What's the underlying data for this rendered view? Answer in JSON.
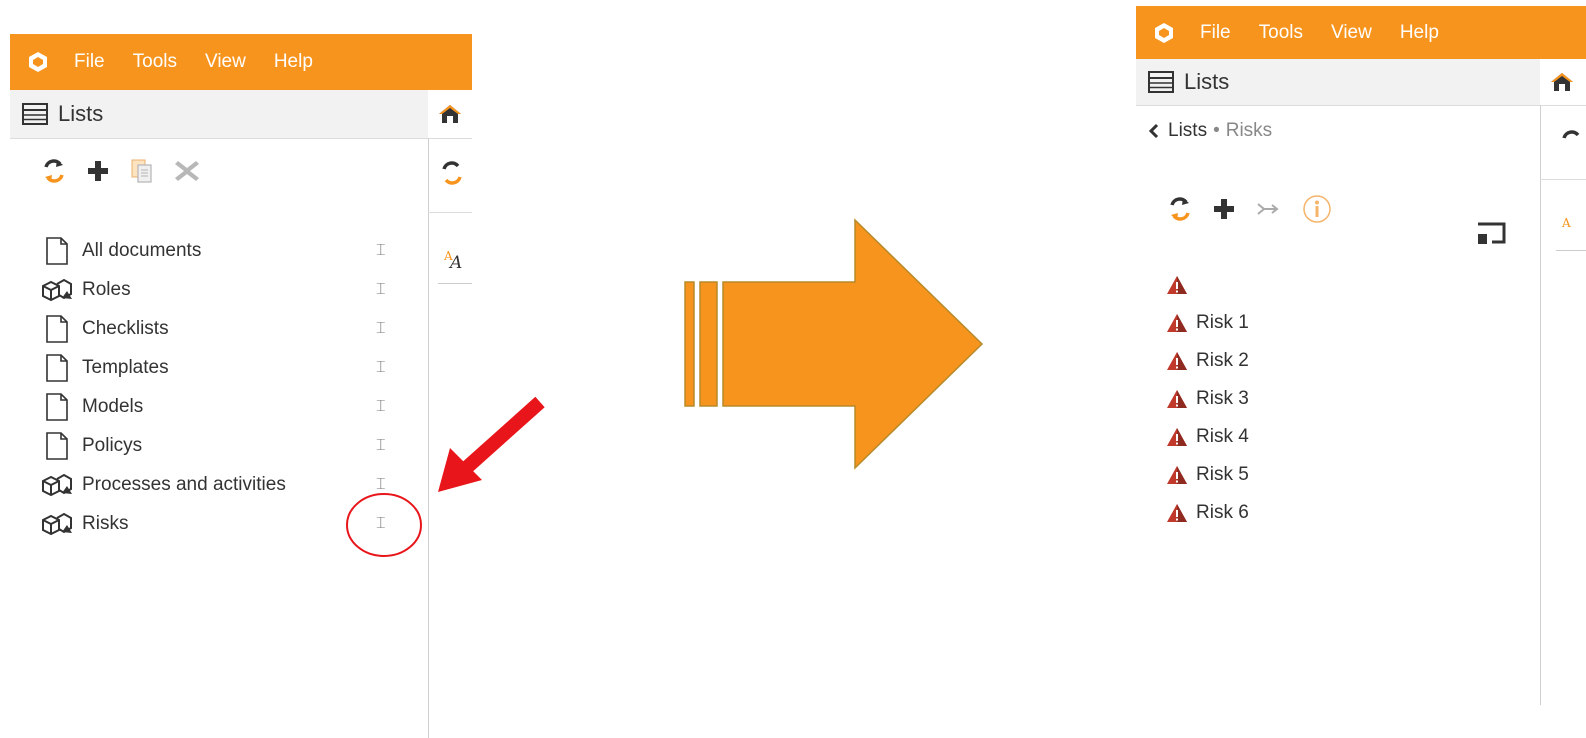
{
  "left": {
    "menu": [
      "File",
      "Tools",
      "View",
      "Help"
    ],
    "panel_title": "Lists",
    "items": [
      {
        "label": "All documents",
        "icon": "document-icon"
      },
      {
        "label": "Roles",
        "icon": "cubes-icon"
      },
      {
        "label": "Checklists",
        "icon": "document-icon"
      },
      {
        "label": "Templates",
        "icon": "document-icon"
      },
      {
        "label": "Models",
        "icon": "document-icon"
      },
      {
        "label": "Policys",
        "icon": "document-icon"
      },
      {
        "label": "Processes and activities",
        "icon": "cubes-icon"
      },
      {
        "label": "Risks",
        "icon": "cubes-icon"
      }
    ],
    "handle_glyph": "⌶"
  },
  "right": {
    "menu": [
      "File",
      "Tools",
      "View",
      "Help"
    ],
    "panel_title": "Lists",
    "breadcrumb": {
      "root": "Lists",
      "sep": "•",
      "current": "Risks"
    },
    "items": [
      "",
      "Risk 1",
      "Risk 2",
      "Risk 3",
      "Risk 4",
      "Risk 5",
      "Risk 6"
    ]
  },
  "colors": {
    "brand": "#f7941d",
    "arrow": "#f7941d",
    "arrow_stroke": "#b78a2a",
    "annotation": "#e8161b",
    "risk": "#c0392b"
  }
}
